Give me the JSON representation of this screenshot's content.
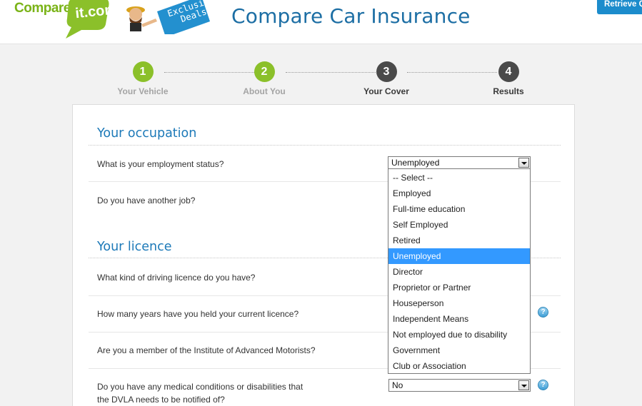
{
  "header": {
    "logo_text": "Compare",
    "logo_bubble_text": "it.com",
    "deals_line1": "Exclusive",
    "deals_line2": "Deals",
    "page_title": "Compare Car Insurance",
    "retrieve_label": "Retrieve Q"
  },
  "steps": [
    {
      "number": "1",
      "label": "Your Vehicle",
      "state": "done"
    },
    {
      "number": "2",
      "label": "About You",
      "state": "done"
    },
    {
      "number": "3",
      "label": "Your Cover",
      "state": "todo"
    },
    {
      "number": "4",
      "label": "Results",
      "state": "todo"
    }
  ],
  "occupation": {
    "title": "Your occupation",
    "employment_question": "What is your employment status?",
    "employment_value": "Unemployed",
    "another_job_question": "Do you have another job?"
  },
  "licence": {
    "title": "Your licence",
    "licence_type_question": "What kind of driving licence do you have?",
    "years_question": "How many years have you held your current licence?",
    "iam_question": "Are you a member of the Institute of Advanced Motorists?",
    "medical_question_line1": "Do you have any medical conditions or disabilities that",
    "medical_question_line2": "the DVLA needs to be notified of?",
    "medical_value": "No"
  },
  "help_icon_glyph": "?",
  "employment_options": [
    "-- Select --",
    "Employed",
    "Full-time education",
    "Self Employed",
    "Retired",
    "Unemployed",
    "Director",
    "Proprietor or Partner",
    "Houseperson",
    "Independent Means",
    "Not employed due to disability",
    "Government",
    "Club or Association"
  ],
  "employment_selected_index": 5,
  "colors": {
    "brand_green": "#8bc02a",
    "brand_blue": "#1c6ea4",
    "selection_blue": "#3399ff"
  }
}
